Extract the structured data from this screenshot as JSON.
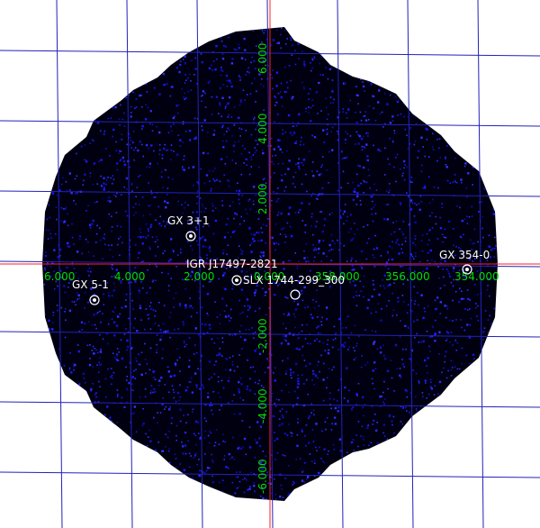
{
  "image": {
    "background_color": "#ffffff",
    "field_color": "#000010",
    "noise_color": "#1a1aff",
    "grid_color": "#2222bb",
    "crosshair_color": "#ff2020",
    "label_color": "#00dd00",
    "source_color": "#ffffff"
  },
  "longitude_labels": [
    "6.000",
    "4.000",
    "2.000",
    "0.000",
    "358.000",
    "356.000",
    "354.000"
  ],
  "latitude_labels": [
    "6.000",
    "4.000",
    "2.000",
    "-2.000",
    "-4.000",
    "-6.000"
  ],
  "sources": [
    {
      "name": "GX 3+1"
    },
    {
      "name": "IGR J17497-2821"
    },
    {
      "name": "SLX 1744-299_300"
    },
    {
      "name": "GX 354-0"
    },
    {
      "name": "GX 5-1"
    }
  ]
}
